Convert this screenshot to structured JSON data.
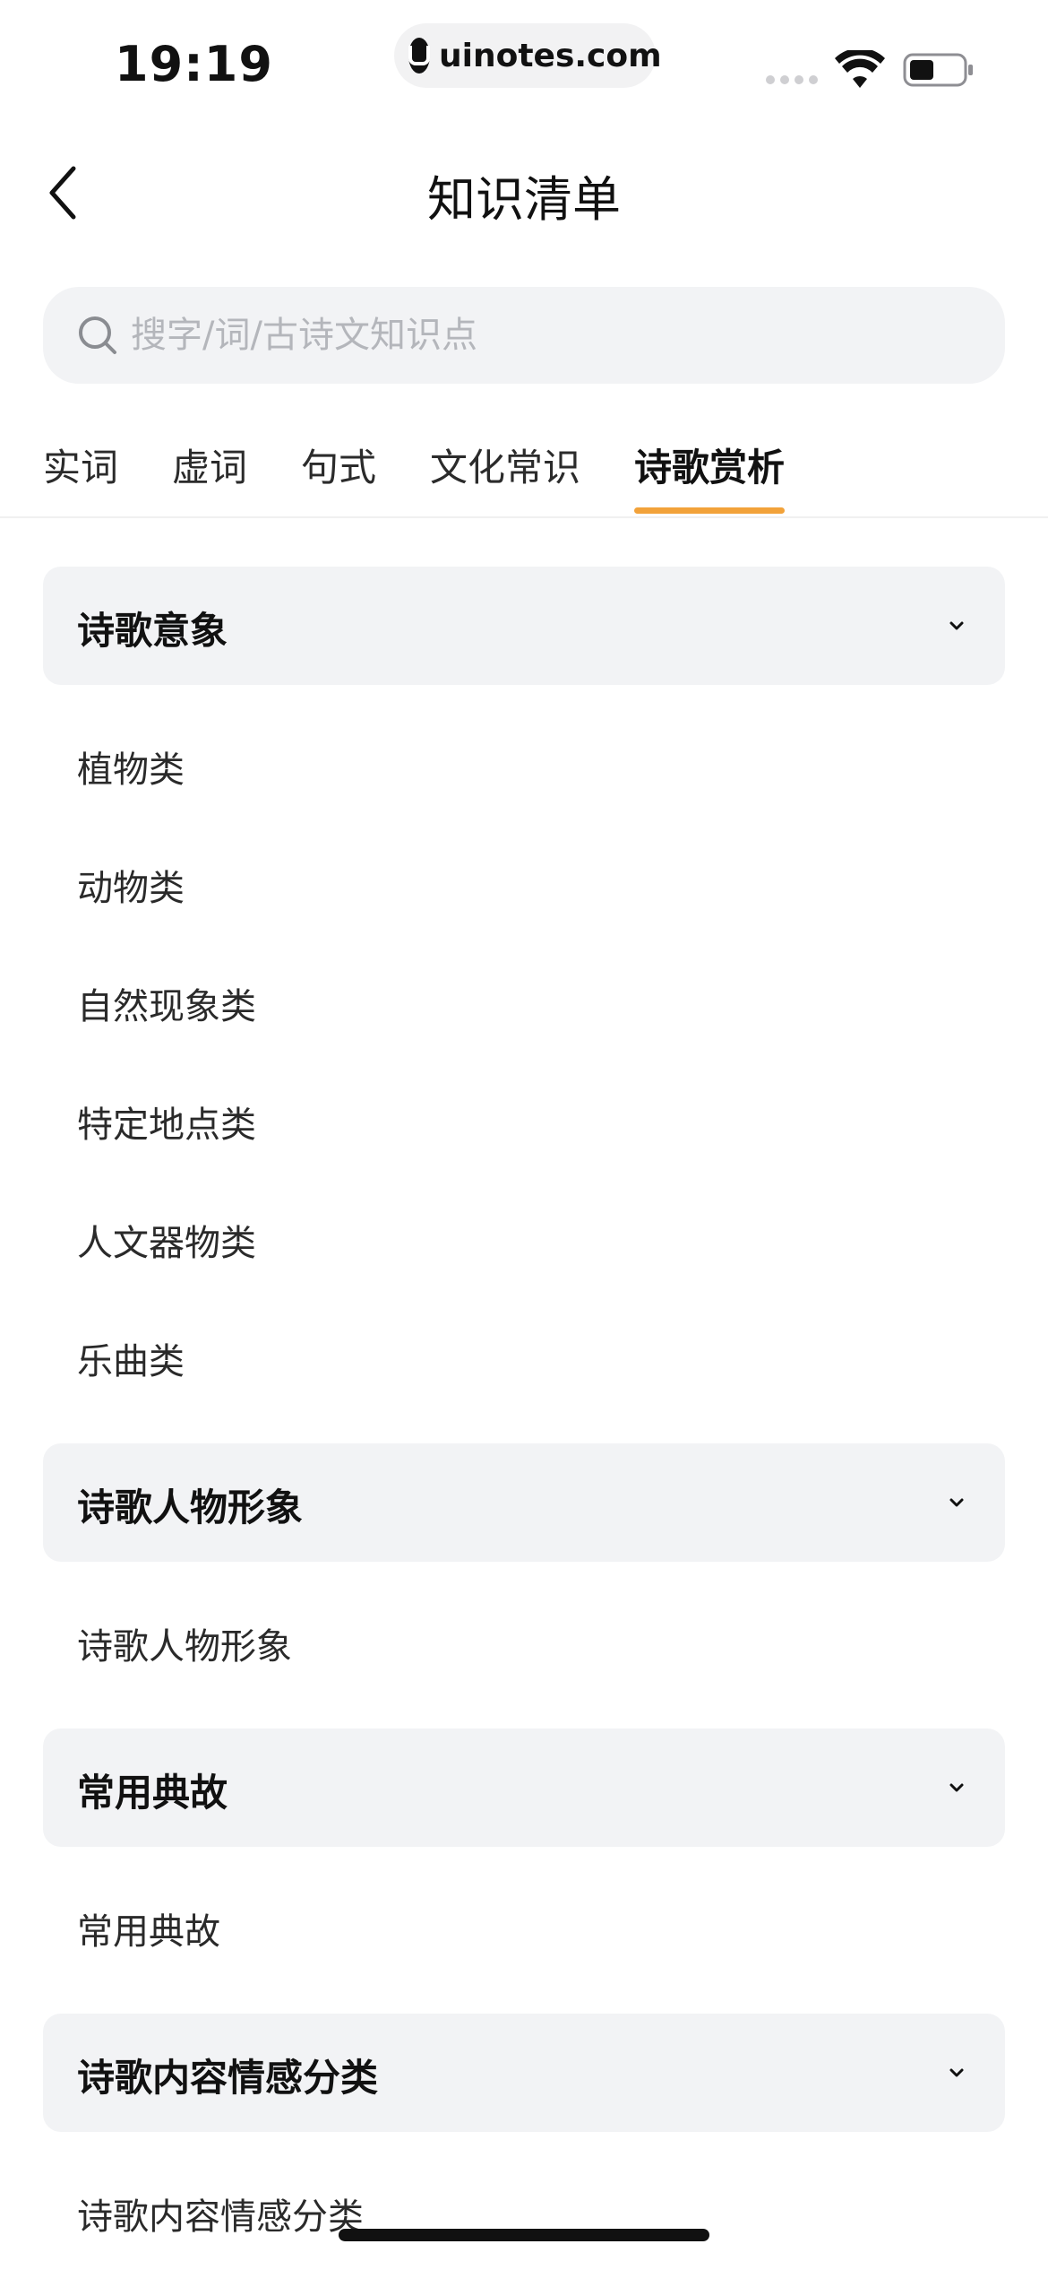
{
  "status_bar": {
    "time": "19:19",
    "url": "uinotes.com",
    "icons": [
      "signal-icon",
      "wifi-icon",
      "battery-icon"
    ]
  },
  "nav": {
    "back_icon": "chevron-left-icon",
    "title": "知识清单"
  },
  "search": {
    "placeholder": "搜字/词/古诗文知识点",
    "value": "",
    "icon": "search-icon"
  },
  "tabs": [
    {
      "label": "实词",
      "active": false
    },
    {
      "label": "虚词",
      "active": false
    },
    {
      "label": "句式",
      "active": false
    },
    {
      "label": "文化常识",
      "active": false
    },
    {
      "label": "诗歌赏析",
      "active": true
    }
  ],
  "colors": {
    "accent": "#f2a23a",
    "section_bg": "#f2f3f5",
    "text": "#1f1f1f",
    "placeholder": "#b4b6bb"
  },
  "sections": [
    {
      "title": "诗歌意象",
      "expanded": true,
      "items": [
        "植物类",
        "动物类",
        "自然现象类",
        "特定地点类",
        "人文器物类",
        "乐曲类"
      ]
    },
    {
      "title": "诗歌人物形象",
      "expanded": true,
      "items": [
        "诗歌人物形象"
      ]
    },
    {
      "title": "常用典故",
      "expanded": true,
      "items": [
        "常用典故"
      ]
    },
    {
      "title": "诗歌内容情感分类",
      "expanded": true,
      "items": [
        "诗歌内容情感分类"
      ]
    }
  ]
}
